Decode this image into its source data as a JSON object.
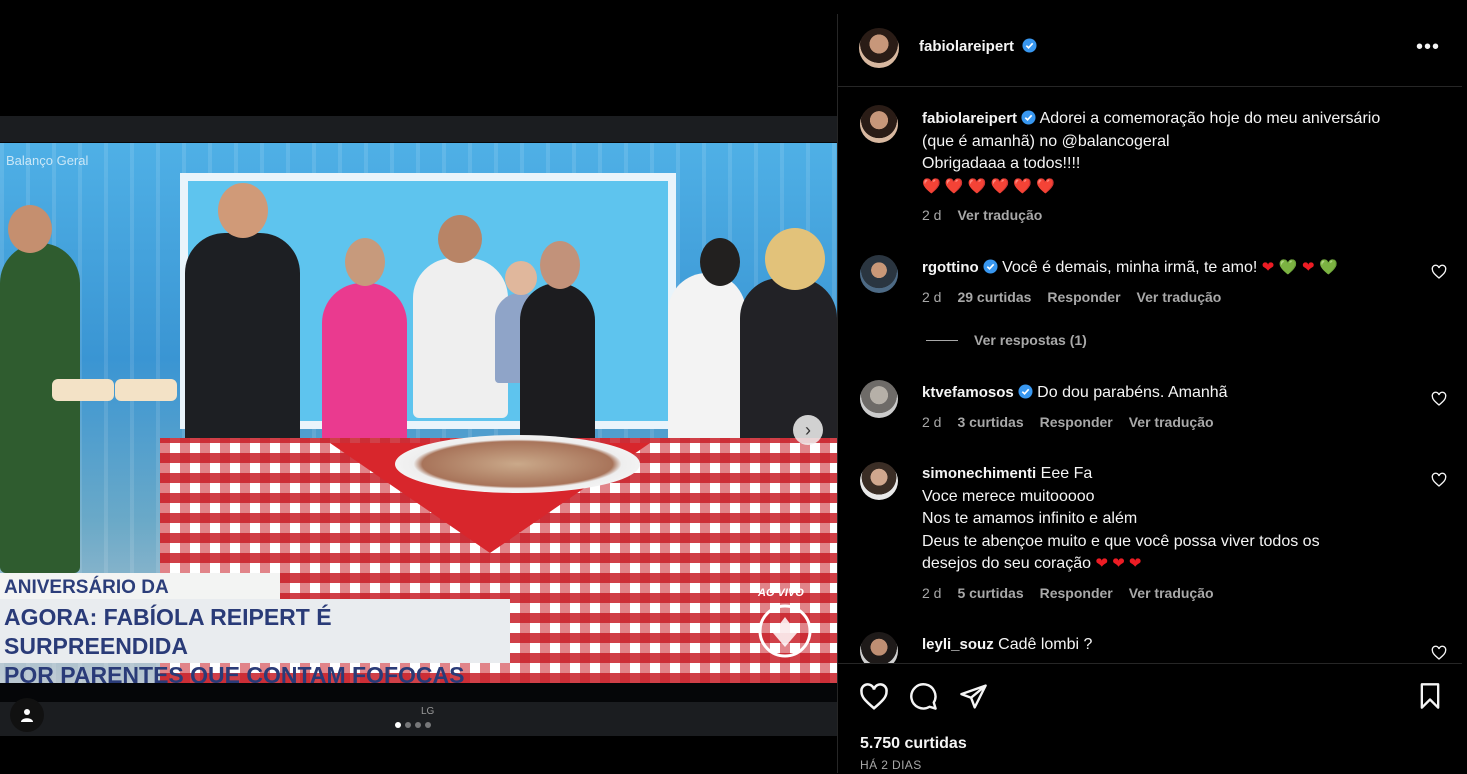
{
  "media": {
    "tv_text": {
      "watermark": "Balanço Geral",
      "lower_third_top": "ANIVERSÁRIO DA \"VENENOSA\"",
      "lower_third_line1": "AGORA: FABÍOLA REIPERT É SURPREENDIDA",
      "lower_third_line2": "POR PARENTES QUE CONTAM FOFOCAS DELA",
      "live_label": "AO VIVO",
      "tv_brand": "LG"
    },
    "carousel": {
      "count": 4,
      "active_index": 0
    }
  },
  "post": {
    "author": "fabiolareipert",
    "caption": {
      "username": "fabiolareipert",
      "line1": "Adorei a comemoração hoje do meu aniversário",
      "line2": "(que é amanhã) no @balancogeral",
      "line3": "Obrigadaaa a todos!!!!",
      "emoji_line": "❤️ ❤️ ❤️ ❤️ ❤️ ❤️",
      "time": "2 d",
      "translate": "Ver tradução"
    },
    "comments": [
      {
        "username": "rgottino",
        "text": "Você é demais, minha irmã, te amo!",
        "emojis": [
          "❤",
          "💚",
          "❤",
          "💚"
        ],
        "time": "2 d",
        "likes": "29 curtidas",
        "reply": "Responder",
        "translate": "Ver tradução",
        "view_replies": "Ver respostas (1)"
      },
      {
        "username": "ktvefamosos",
        "text": "Do dou parabéns. Amanhã",
        "time": "2 d",
        "likes": "3 curtidas",
        "reply": "Responder",
        "translate": "Ver tradução"
      },
      {
        "username": "simonechimenti",
        "text_line1": "Eee Fa",
        "text_line2": "Voce merece muitooooo",
        "text_line3": "Nos te amamos infinito e além",
        "text_line4": "Deus te abençoe muito e que você possa viver todos os",
        "text_line5": "desejos do seu coração",
        "emojis": "❤ ❤ ❤",
        "time": "2 d",
        "likes": "5 curtidas",
        "reply": "Responder",
        "translate": "Ver tradução"
      },
      {
        "username": "leyli_souz",
        "text": "Cadê lombi ?"
      }
    ],
    "likes_count": "5.750 curtidas",
    "posted": "HÁ 2 DIAS"
  }
}
